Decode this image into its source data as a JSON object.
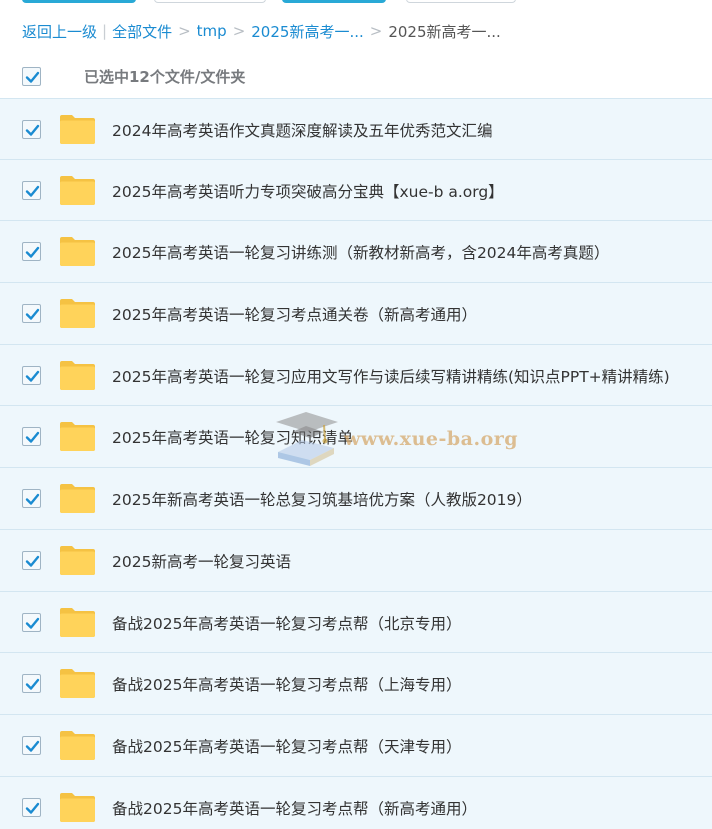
{
  "breadcrumb": {
    "back": "返回上一级",
    "all_files": "全部文件",
    "sep": ">",
    "items": [
      "tmp",
      "2025新高考一...",
      "2025新高考一..."
    ]
  },
  "selection": {
    "count_label": "已选中12个文件/文件夹"
  },
  "watermark": {
    "text": "www.xue-ba.org"
  },
  "files": [
    {
      "name": "2024年高考英语作文真题深度解读及五年优秀范文汇编",
      "checked": true,
      "type": "folder-icon"
    },
    {
      "name": "2025年高考英语听力专项突破高分宝典【xue-b a.org】",
      "checked": true,
      "type": "folder-icon"
    },
    {
      "name": "2025年高考英语一轮复习讲练测（新教材新高考，含2024年高考真题）",
      "checked": true,
      "type": "folder-icon"
    },
    {
      "name": "2025年高考英语一轮复习考点通关卷（新高考通用）",
      "checked": true,
      "type": "folder-icon"
    },
    {
      "name": "2025年高考英语一轮复习应用文写作与读后续写精讲精练(知识点PPT+精讲精练)",
      "checked": true,
      "type": "folder-icon"
    },
    {
      "name": "2025年高考英语一轮复习知识清单",
      "checked": true,
      "type": "folder-icon"
    },
    {
      "name": "2025年新高考英语一轮总复习筑基培优方案（人教版2019）",
      "checked": true,
      "type": "folder-icon"
    },
    {
      "name": "2025新高考一轮复习英语",
      "checked": true,
      "type": "folder-icon"
    },
    {
      "name": "备战2025年高考英语一轮复习考点帮（北京专用）",
      "checked": true,
      "type": "folder-icon"
    },
    {
      "name": "备战2025年高考英语一轮复习考点帮（上海专用）",
      "checked": true,
      "type": "folder-icon"
    },
    {
      "name": "备战2025年高考英语一轮复习考点帮（天津专用）",
      "checked": true,
      "type": "folder-icon"
    },
    {
      "name": "备战2025年高考英语一轮复习考点帮（新高考通用）",
      "checked": true,
      "type": "folder-icon"
    }
  ],
  "colors": {
    "link": "#1a8bd1",
    "row_bg": "#eef7fc",
    "check": "#1a8bd1",
    "folder": "#ffd35a"
  }
}
